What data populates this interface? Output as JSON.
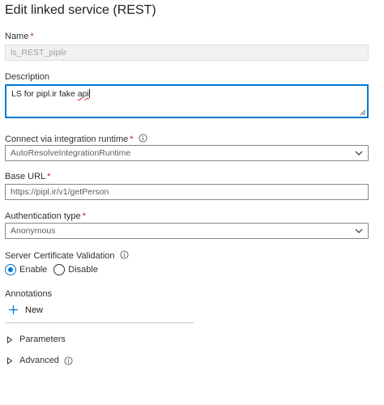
{
  "panel": {
    "title": "Edit linked service (REST)"
  },
  "name": {
    "label": "Name",
    "required_mark": "*",
    "value": "ls_REST_piplir"
  },
  "description": {
    "label": "Description",
    "text_before": "LS for pipl.ir fake ",
    "misspelled": "api"
  },
  "integration_runtime": {
    "label": "Connect via integration runtime",
    "required_mark": "*",
    "selected": "AutoResolveIntegrationRuntime"
  },
  "base_url": {
    "label": "Base URL",
    "required_mark": "*",
    "value": "https://pipl.ir/v1/getPerson"
  },
  "authentication": {
    "label": "Authentication type",
    "required_mark": "*",
    "selected": "Anonymous"
  },
  "cert_validation": {
    "label": "Server Certificate Validation",
    "options": [
      {
        "label": "Enable",
        "checked": true
      },
      {
        "label": "Disable",
        "checked": false
      }
    ]
  },
  "annotations": {
    "label": "Annotations",
    "new_label": "New"
  },
  "sections": {
    "parameters": "Parameters",
    "advanced": "Advanced"
  },
  "colors": {
    "accent": "#0078d4",
    "required": "#a4262c"
  }
}
